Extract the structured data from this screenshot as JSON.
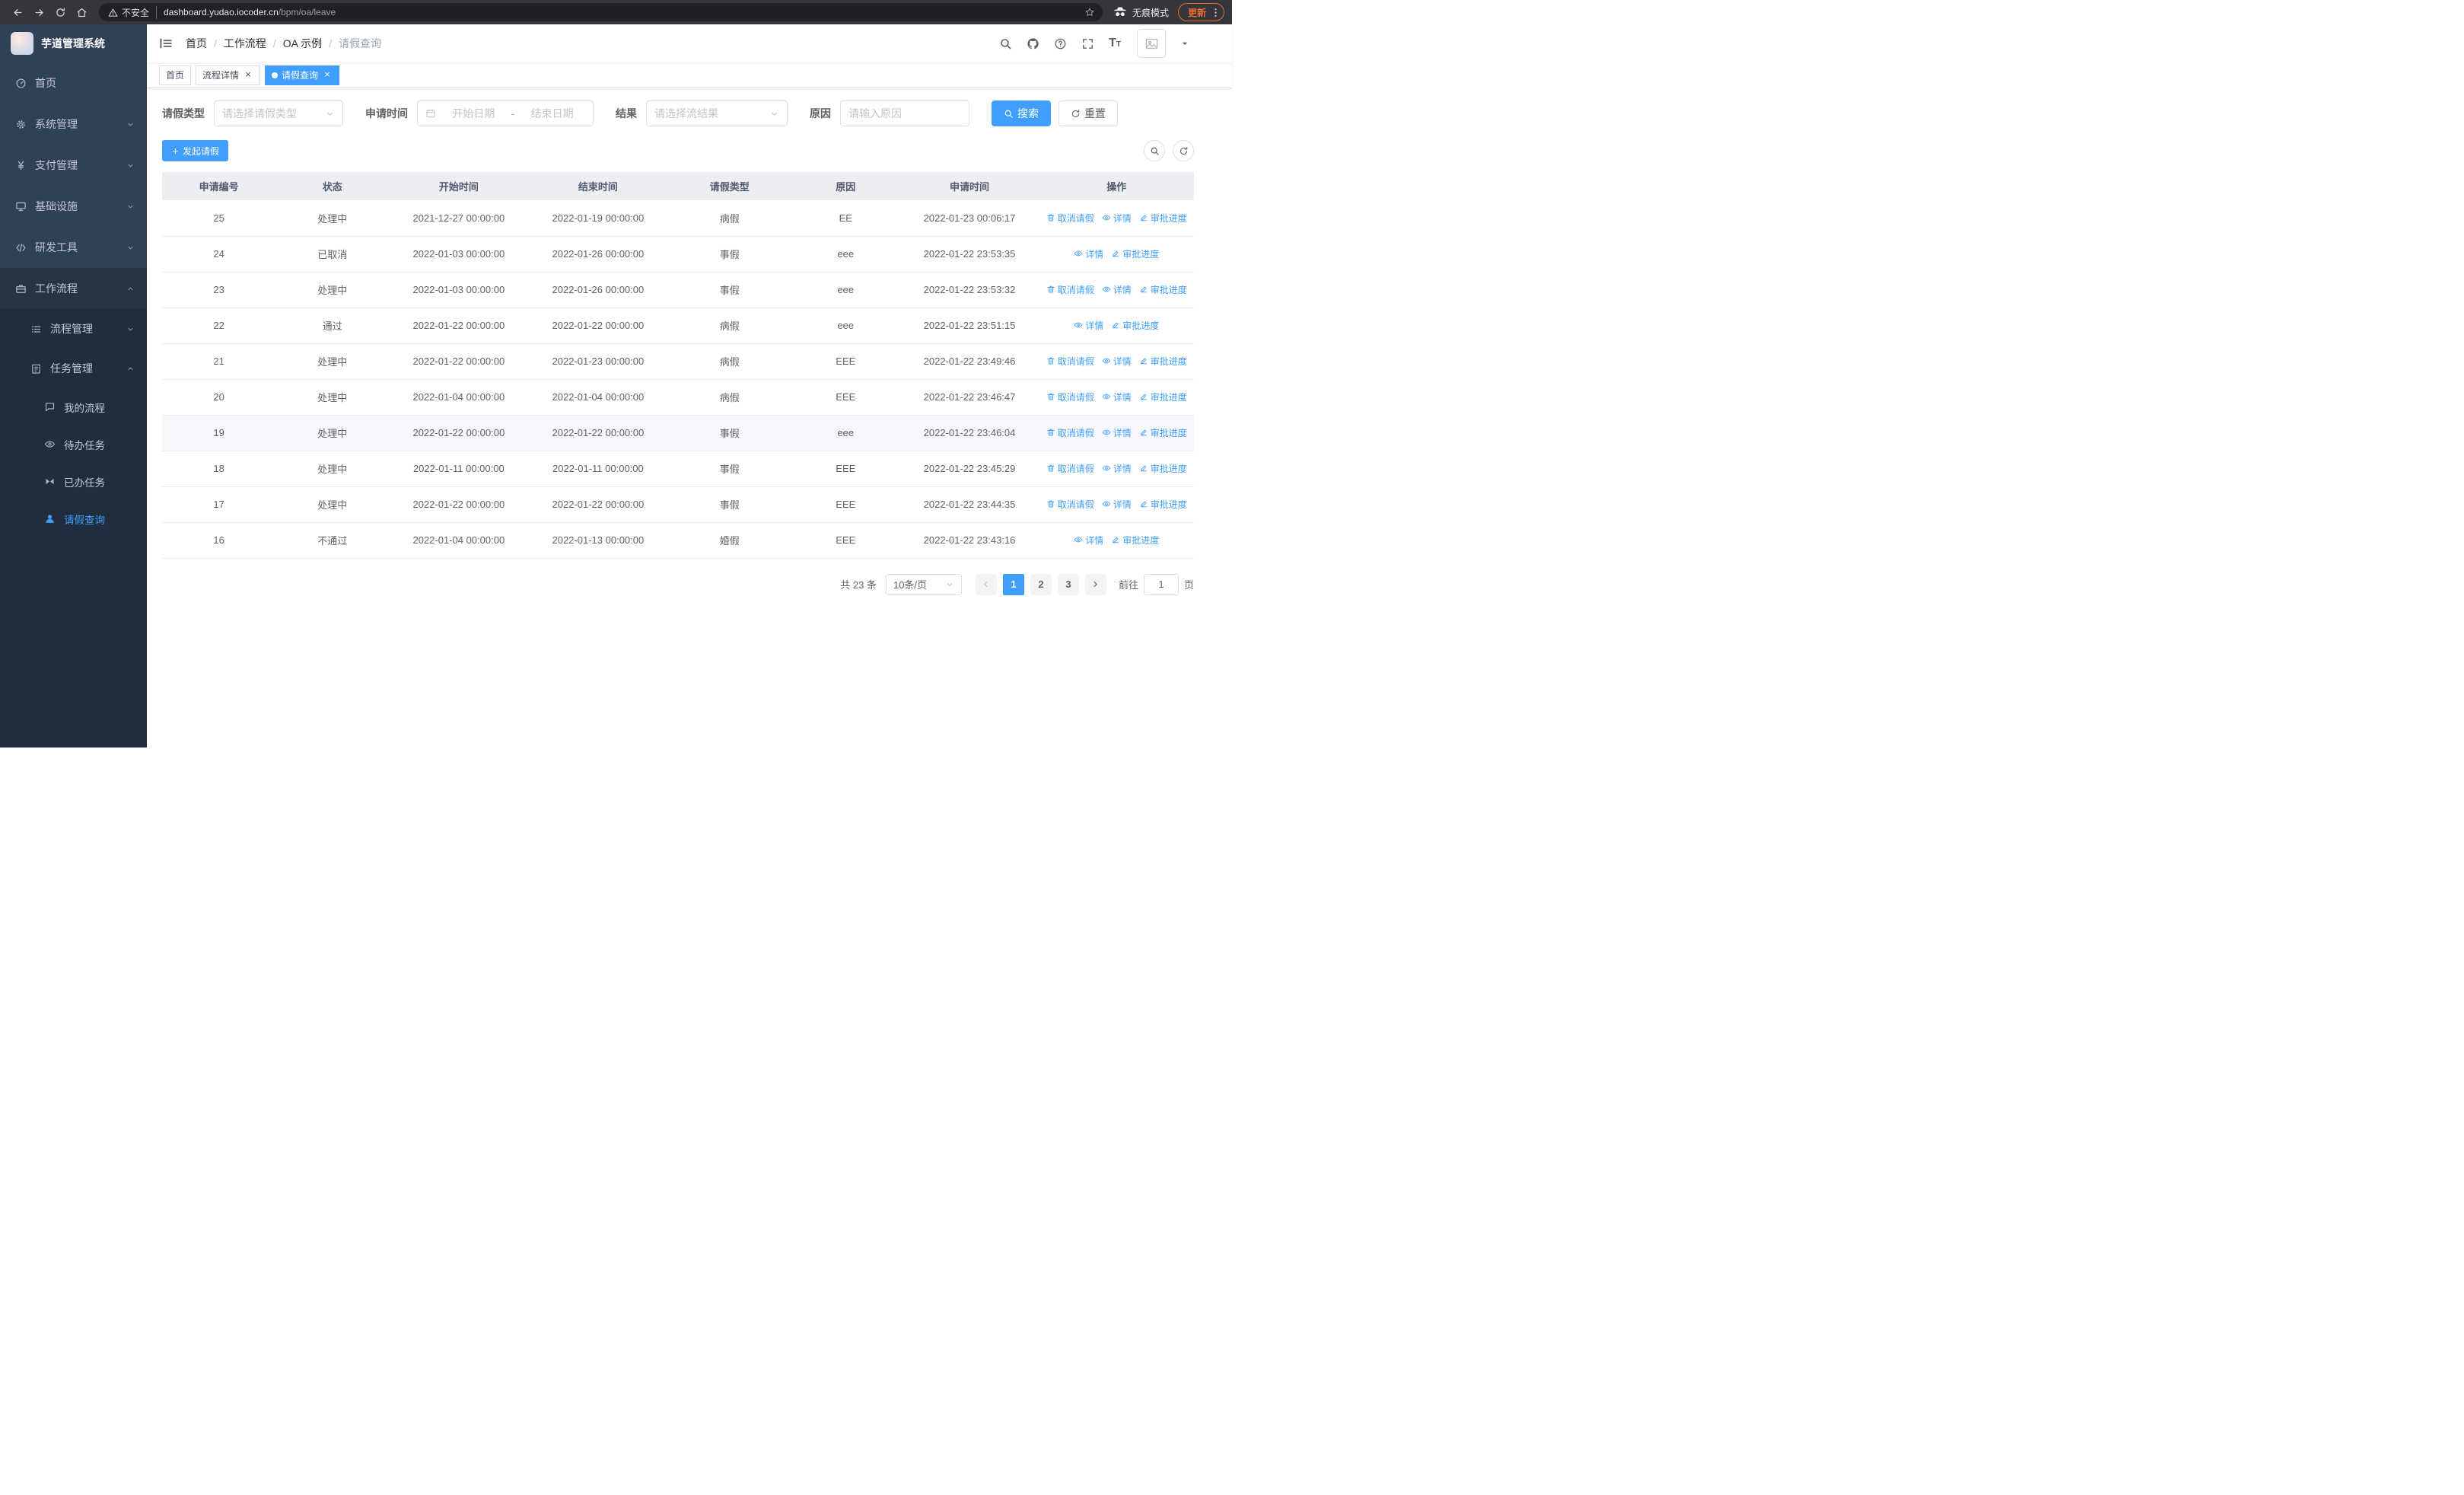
{
  "colors": {
    "primary": "#409eff",
    "sidebar_bg": "#304156",
    "sidebar_sub_bg": "#1f2d3d",
    "active_tab_bg": "#409eff",
    "update_chip": "#ef6a35"
  },
  "browser": {
    "security_label": "不安全",
    "url_host": "dashboard.yudao.iocoder.cn",
    "url_path": "/bpm/oa/leave",
    "incognito_label": "无痕模式",
    "update_label": "更新"
  },
  "sidebar": {
    "logo_title": "芋道管理系统",
    "menu": [
      {
        "name": "home",
        "label": "首页",
        "icon": "dashboard-icon",
        "level": 1
      },
      {
        "name": "system-management",
        "label": "系统管理",
        "icon": "gear-icon",
        "level": 1,
        "arrow": "down"
      },
      {
        "name": "payment-management",
        "label": "支付管理",
        "icon": "yen-icon",
        "level": 1,
        "arrow": "down"
      },
      {
        "name": "infrastructure",
        "label": "基础设施",
        "icon": "infrastructure-icon",
        "level": 1,
        "arrow": "down"
      },
      {
        "name": "dev-tools",
        "label": "研发工具",
        "icon": "devtools-icon",
        "level": 1,
        "arrow": "down"
      },
      {
        "name": "workflow",
        "label": "工作流程",
        "icon": "workflow-icon",
        "level": 1,
        "arrow": "up",
        "open": true
      },
      {
        "name": "process-management",
        "label": "流程管理",
        "icon": "process-icon",
        "level": 2,
        "arrow": "down"
      },
      {
        "name": "task-management",
        "label": "任务管理",
        "icon": "task-icon",
        "level": 2,
        "arrow": "up",
        "open": true
      },
      {
        "name": "my-processes",
        "label": "我的流程",
        "icon": "chat-icon",
        "level": 3
      },
      {
        "name": "todo-tasks",
        "label": "待办任务",
        "icon": "eye-icon",
        "level": 3
      },
      {
        "name": "done-tasks",
        "label": "已办任务",
        "icon": "done-icon",
        "level": 3
      },
      {
        "name": "leave-query",
        "label": "请假查询",
        "icon": "user-icon",
        "level": 3,
        "active": true
      }
    ]
  },
  "header": {
    "breadcrumb_separator": "/",
    "breadcrumb": [
      {
        "label": "首页"
      },
      {
        "label": "工作流程"
      },
      {
        "label": "OA 示例"
      },
      {
        "label": "请假查询",
        "current": true
      }
    ]
  },
  "tags": [
    {
      "name": "home",
      "label": "首页",
      "closable": false,
      "active": false
    },
    {
      "name": "process-detail",
      "label": "流程详情",
      "closable": true,
      "active": false
    },
    {
      "name": "leave-query",
      "label": "请假查询",
      "closable": true,
      "active": true
    }
  ],
  "filters": {
    "leave_type": {
      "label": "请假类型",
      "placeholder": "请选择请假类型"
    },
    "apply_time": {
      "label": "申请时间",
      "start_placeholder": "开始日期",
      "separator": "-",
      "end_placeholder": "结束日期"
    },
    "result": {
      "label": "结果",
      "placeholder": "请选择流结果"
    },
    "reason": {
      "label": "原因",
      "placeholder": "请输入原因"
    },
    "search_label": "搜索",
    "reset_label": "重置"
  },
  "toolbar": {
    "create_label": "发起请假"
  },
  "table": {
    "columns": [
      "申请编号",
      "状态",
      "开始时间",
      "结束时间",
      "请假类型",
      "原因",
      "申请时间",
      "操作"
    ],
    "action_labels": {
      "cancel": "取消请假",
      "detail": "详情",
      "progress": "审批进度"
    },
    "rows": [
      {
        "id": "25",
        "status": "处理中",
        "start_time": "2021-12-27 00:00:00",
        "end_time": "2022-01-19 00:00:00",
        "leave_type": "病假",
        "reason": "EE",
        "apply_time": "2022-01-23 00:06:17",
        "cancelable": true
      },
      {
        "id": "24",
        "status": "已取消",
        "start_time": "2022-01-03 00:00:00",
        "end_time": "2022-01-26 00:00:00",
        "leave_type": "事假",
        "reason": "eee",
        "apply_time": "2022-01-22 23:53:35",
        "cancelable": false
      },
      {
        "id": "23",
        "status": "处理中",
        "start_time": "2022-01-03 00:00:00",
        "end_time": "2022-01-26 00:00:00",
        "leave_type": "事假",
        "reason": "eee",
        "apply_time": "2022-01-22 23:53:32",
        "cancelable": true
      },
      {
        "id": "22",
        "status": "通过",
        "start_time": "2022-01-22 00:00:00",
        "end_time": "2022-01-22 00:00:00",
        "leave_type": "病假",
        "reason": "eee",
        "apply_time": "2022-01-22 23:51:15",
        "cancelable": false
      },
      {
        "id": "21",
        "status": "处理中",
        "start_time": "2022-01-22 00:00:00",
        "end_time": "2022-01-23 00:00:00",
        "leave_type": "病假",
        "reason": "EEE",
        "apply_time": "2022-01-22 23:49:46",
        "cancelable": true
      },
      {
        "id": "20",
        "status": "处理中",
        "start_time": "2022-01-04 00:00:00",
        "end_time": "2022-01-04 00:00:00",
        "leave_type": "病假",
        "reason": "EEE",
        "apply_time": "2022-01-22 23:46:47",
        "cancelable": true
      },
      {
        "id": "19",
        "status": "处理中",
        "start_time": "2022-01-22 00:00:00",
        "end_time": "2022-01-22 00:00:00",
        "leave_type": "事假",
        "reason": "eee",
        "apply_time": "2022-01-22 23:46:04",
        "cancelable": true,
        "highlighted": true
      },
      {
        "id": "18",
        "status": "处理中",
        "start_time": "2022-01-11 00:00:00",
        "end_time": "2022-01-11 00:00:00",
        "leave_type": "事假",
        "reason": "EEE",
        "apply_time": "2022-01-22 23:45:29",
        "cancelable": true
      },
      {
        "id": "17",
        "status": "处理中",
        "start_time": "2022-01-22 00:00:00",
        "end_time": "2022-01-22 00:00:00",
        "leave_type": "事假",
        "reason": "EEE",
        "apply_time": "2022-01-22 23:44:35",
        "cancelable": true
      },
      {
        "id": "16",
        "status": "不通过",
        "start_time": "2022-01-04 00:00:00",
        "end_time": "2022-01-13 00:00:00",
        "leave_type": "婚假",
        "reason": "EEE",
        "apply_time": "2022-01-22 23:43:16",
        "cancelable": false
      }
    ]
  },
  "pagination": {
    "total_label": "共 23 条",
    "page_size_label": "10条/页",
    "pages": [
      "1",
      "2",
      "3"
    ],
    "active_page": "1",
    "goto_label": "前往",
    "goto_value": "1",
    "unit_label": "页"
  }
}
